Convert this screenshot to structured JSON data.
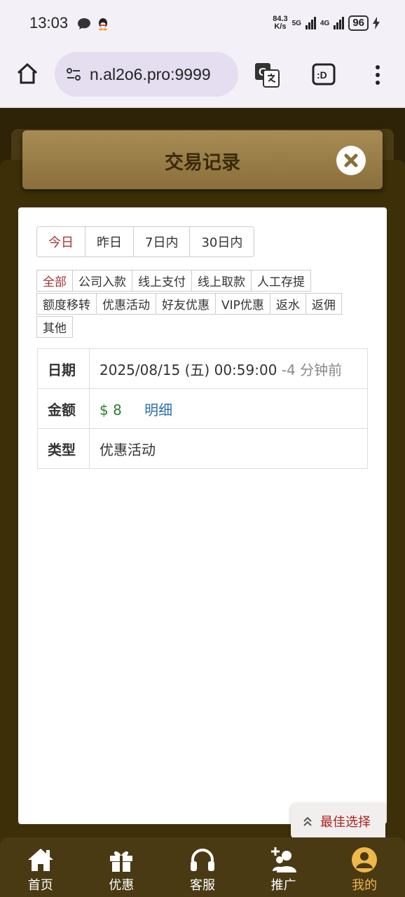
{
  "status_bar": {
    "time": "13:03",
    "net_speed_value": "84.3",
    "net_speed_unit": "K/s",
    "net_5g": "5G",
    "net_4g": "4G",
    "battery": "96"
  },
  "browser": {
    "url": "n.al2o6.pro:9999"
  },
  "header": {
    "title": "交易记录"
  },
  "date_filters": [
    {
      "label": "今日",
      "active": true
    },
    {
      "label": "昨日",
      "active": false
    },
    {
      "label": "7日内",
      "active": false
    },
    {
      "label": "30日内",
      "active": false
    }
  ],
  "type_filters": [
    {
      "label": "全部",
      "active": true
    },
    {
      "label": "公司入款",
      "active": false
    },
    {
      "label": "线上支付",
      "active": false
    },
    {
      "label": "线上取款",
      "active": false
    },
    {
      "label": "人工存提",
      "active": false
    },
    {
      "label": "额度移转",
      "active": false
    },
    {
      "label": "优惠活动",
      "active": false
    },
    {
      "label": "好友优惠",
      "active": false
    },
    {
      "label": "VIP优惠",
      "active": false
    },
    {
      "label": "返水",
      "active": false
    },
    {
      "label": "返佣",
      "active": false
    },
    {
      "label": "其他",
      "active": false
    }
  ],
  "record": {
    "date_label": "日期",
    "date_value": "2025/08/15 (五) 00:59:00",
    "date_relative": "-4 分钟前",
    "amount_label": "金额",
    "amount_value": "$ 8",
    "detail_link": "明细",
    "type_label": "类型",
    "type_value": "优惠活动"
  },
  "best_choice": {
    "label": "最佳选择"
  },
  "bottom_nav": [
    {
      "label": "首页",
      "icon": "home-icon",
      "active": false
    },
    {
      "label": "优惠",
      "icon": "gift-icon",
      "active": false
    },
    {
      "label": "客服",
      "icon": "headset-icon",
      "active": false
    },
    {
      "label": "推广",
      "icon": "add-user-icon",
      "active": false
    },
    {
      "label": "我的",
      "icon": "user-icon",
      "active": true
    }
  ],
  "colors": {
    "accent_active": "#a33",
    "nav_active": "#f0b84a",
    "header_gold": "#a88c56",
    "amount_green": "#2e7d32",
    "link_blue": "#2a6fb0"
  }
}
